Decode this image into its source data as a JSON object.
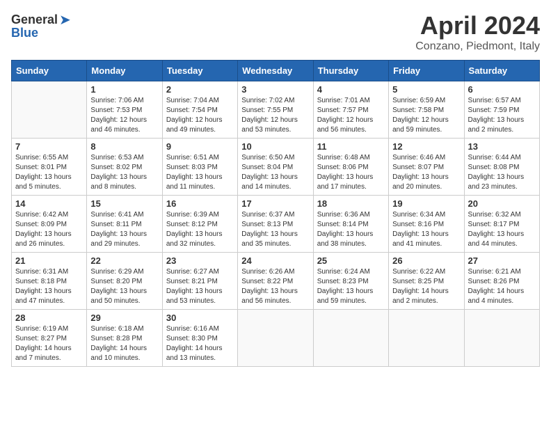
{
  "header": {
    "logo_general": "General",
    "logo_blue": "Blue",
    "month_title": "April 2024",
    "location": "Conzano, Piedmont, Italy"
  },
  "days_of_week": [
    "Sunday",
    "Monday",
    "Tuesday",
    "Wednesday",
    "Thursday",
    "Friday",
    "Saturday"
  ],
  "weeks": [
    [
      {
        "day": "",
        "info": ""
      },
      {
        "day": "1",
        "info": "Sunrise: 7:06 AM\nSunset: 7:53 PM\nDaylight: 12 hours\nand 46 minutes."
      },
      {
        "day": "2",
        "info": "Sunrise: 7:04 AM\nSunset: 7:54 PM\nDaylight: 12 hours\nand 49 minutes."
      },
      {
        "day": "3",
        "info": "Sunrise: 7:02 AM\nSunset: 7:55 PM\nDaylight: 12 hours\nand 53 minutes."
      },
      {
        "day": "4",
        "info": "Sunrise: 7:01 AM\nSunset: 7:57 PM\nDaylight: 12 hours\nand 56 minutes."
      },
      {
        "day": "5",
        "info": "Sunrise: 6:59 AM\nSunset: 7:58 PM\nDaylight: 12 hours\nand 59 minutes."
      },
      {
        "day": "6",
        "info": "Sunrise: 6:57 AM\nSunset: 7:59 PM\nDaylight: 13 hours\nand 2 minutes."
      }
    ],
    [
      {
        "day": "7",
        "info": "Sunrise: 6:55 AM\nSunset: 8:01 PM\nDaylight: 13 hours\nand 5 minutes."
      },
      {
        "day": "8",
        "info": "Sunrise: 6:53 AM\nSunset: 8:02 PM\nDaylight: 13 hours\nand 8 minutes."
      },
      {
        "day": "9",
        "info": "Sunrise: 6:51 AM\nSunset: 8:03 PM\nDaylight: 13 hours\nand 11 minutes."
      },
      {
        "day": "10",
        "info": "Sunrise: 6:50 AM\nSunset: 8:04 PM\nDaylight: 13 hours\nand 14 minutes."
      },
      {
        "day": "11",
        "info": "Sunrise: 6:48 AM\nSunset: 8:06 PM\nDaylight: 13 hours\nand 17 minutes."
      },
      {
        "day": "12",
        "info": "Sunrise: 6:46 AM\nSunset: 8:07 PM\nDaylight: 13 hours\nand 20 minutes."
      },
      {
        "day": "13",
        "info": "Sunrise: 6:44 AM\nSunset: 8:08 PM\nDaylight: 13 hours\nand 23 minutes."
      }
    ],
    [
      {
        "day": "14",
        "info": "Sunrise: 6:42 AM\nSunset: 8:09 PM\nDaylight: 13 hours\nand 26 minutes."
      },
      {
        "day": "15",
        "info": "Sunrise: 6:41 AM\nSunset: 8:11 PM\nDaylight: 13 hours\nand 29 minutes."
      },
      {
        "day": "16",
        "info": "Sunrise: 6:39 AM\nSunset: 8:12 PM\nDaylight: 13 hours\nand 32 minutes."
      },
      {
        "day": "17",
        "info": "Sunrise: 6:37 AM\nSunset: 8:13 PM\nDaylight: 13 hours\nand 35 minutes."
      },
      {
        "day": "18",
        "info": "Sunrise: 6:36 AM\nSunset: 8:14 PM\nDaylight: 13 hours\nand 38 minutes."
      },
      {
        "day": "19",
        "info": "Sunrise: 6:34 AM\nSunset: 8:16 PM\nDaylight: 13 hours\nand 41 minutes."
      },
      {
        "day": "20",
        "info": "Sunrise: 6:32 AM\nSunset: 8:17 PM\nDaylight: 13 hours\nand 44 minutes."
      }
    ],
    [
      {
        "day": "21",
        "info": "Sunrise: 6:31 AM\nSunset: 8:18 PM\nDaylight: 13 hours\nand 47 minutes."
      },
      {
        "day": "22",
        "info": "Sunrise: 6:29 AM\nSunset: 8:20 PM\nDaylight: 13 hours\nand 50 minutes."
      },
      {
        "day": "23",
        "info": "Sunrise: 6:27 AM\nSunset: 8:21 PM\nDaylight: 13 hours\nand 53 minutes."
      },
      {
        "day": "24",
        "info": "Sunrise: 6:26 AM\nSunset: 8:22 PM\nDaylight: 13 hours\nand 56 minutes."
      },
      {
        "day": "25",
        "info": "Sunrise: 6:24 AM\nSunset: 8:23 PM\nDaylight: 13 hours\nand 59 minutes."
      },
      {
        "day": "26",
        "info": "Sunrise: 6:22 AM\nSunset: 8:25 PM\nDaylight: 14 hours\nand 2 minutes."
      },
      {
        "day": "27",
        "info": "Sunrise: 6:21 AM\nSunset: 8:26 PM\nDaylight: 14 hours\nand 4 minutes."
      }
    ],
    [
      {
        "day": "28",
        "info": "Sunrise: 6:19 AM\nSunset: 8:27 PM\nDaylight: 14 hours\nand 7 minutes."
      },
      {
        "day": "29",
        "info": "Sunrise: 6:18 AM\nSunset: 8:28 PM\nDaylight: 14 hours\nand 10 minutes."
      },
      {
        "day": "30",
        "info": "Sunrise: 6:16 AM\nSunset: 8:30 PM\nDaylight: 14 hours\nand 13 minutes."
      },
      {
        "day": "",
        "info": ""
      },
      {
        "day": "",
        "info": ""
      },
      {
        "day": "",
        "info": ""
      },
      {
        "day": "",
        "info": ""
      }
    ]
  ]
}
